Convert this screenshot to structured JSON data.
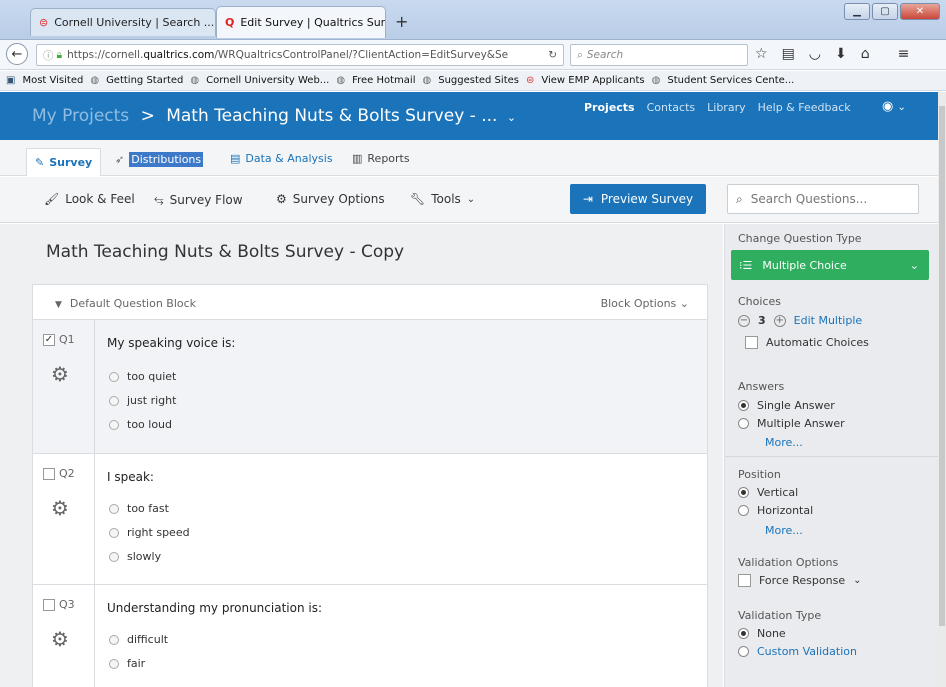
{
  "browser": {
    "tabs": [
      {
        "title": "Cornell University | Search ...",
        "close": "×"
      },
      {
        "title": "Edit Survey | Qualtrics Surv...",
        "close": "×"
      }
    ],
    "new_tab": "+",
    "url_prefix": "https://cornell.",
    "url_host": "qualtrics.com",
    "url_suffix": "/WRQualtricsControlPanel/?ClientAction=EditSurvey&Se",
    "search_placeholder": "Search",
    "bookmarks": [
      "Most Visited",
      "Getting Started",
      "Cornell University Web...",
      "Free Hotmail",
      "Suggested Sites",
      "View EMP Applicants",
      "Student Services Cente..."
    ]
  },
  "header": {
    "my_projects": "My Projects",
    "separator": ">",
    "project_title": "Math Teaching Nuts & Bolts Survey - ...",
    "nav": [
      "Projects",
      "Contacts",
      "Library",
      "Help & Feedback"
    ]
  },
  "tabs": {
    "survey": "Survey",
    "distributions": "Distributions",
    "data_analysis": "Data & Analysis",
    "reports": "Reports"
  },
  "toolbar": {
    "look_feel": "Look & Feel",
    "survey_flow": "Survey Flow",
    "survey_options": "Survey Options",
    "tools": "Tools",
    "preview": "Preview Survey",
    "search_placeholder": "Search Questions..."
  },
  "survey": {
    "title": "Math Teaching Nuts & Bolts Survey - Copy",
    "block_name": "Default Question Block",
    "block_options": "Block Options",
    "questions": [
      {
        "id": "Q1",
        "text": "My speaking voice is:",
        "choices": [
          "too quiet",
          "just right",
          "too loud"
        ],
        "selected": true
      },
      {
        "id": "Q2",
        "text": "I speak:",
        "choices": [
          "too fast",
          "right speed",
          "slowly"
        ],
        "selected": false
      },
      {
        "id": "Q3",
        "text": "Understanding my pronunciation is:",
        "choices": [
          "difficult",
          "fair"
        ],
        "selected": false
      }
    ]
  },
  "panel": {
    "change_type_label": "Change Question Type",
    "question_type": "Multiple Choice",
    "choices_label": "Choices",
    "choices_count": "3",
    "edit_multiple": "Edit Multiple",
    "automatic_choices": "Automatic Choices",
    "answers_label": "Answers",
    "single_answer": "Single Answer",
    "multiple_answer": "Multiple Answer",
    "more": "More...",
    "position_label": "Position",
    "vertical": "Vertical",
    "horizontal": "Horizontal",
    "validation_options_label": "Validation Options",
    "force_response": "Force Response",
    "validation_type_label": "Validation Type",
    "none": "None",
    "custom_validation": "Custom Validation"
  },
  "colors": {
    "brand_blue": "#1b73b9",
    "accent_green": "#2eae5e"
  }
}
